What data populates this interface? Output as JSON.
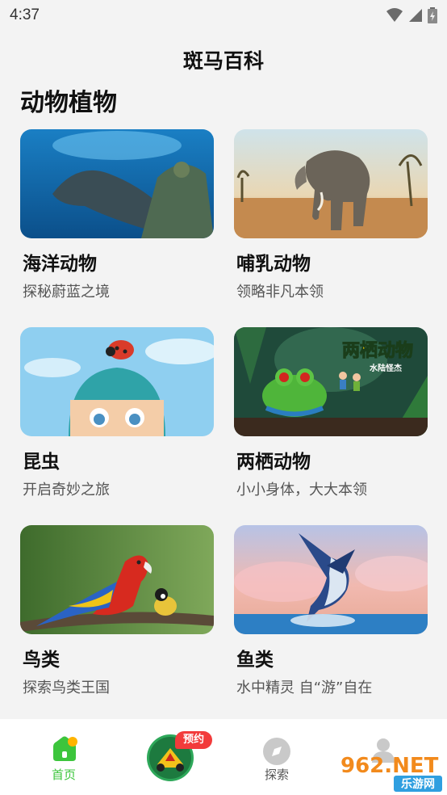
{
  "status_bar": {
    "time": "4:37"
  },
  "header": {
    "title": "斑马百科"
  },
  "section": {
    "title": "动物植物"
  },
  "cards": [
    {
      "title": "海洋动物",
      "subtitle": "探秘蔚蓝之境"
    },
    {
      "title": "哺乳动物",
      "subtitle": "领略非凡本领"
    },
    {
      "title": "昆虫",
      "subtitle": "开启奇妙之旅"
    },
    {
      "title": "两栖动物",
      "subtitle": "小小身体，大大本领"
    },
    {
      "title": "鸟类",
      "subtitle": "探索鸟类王国"
    },
    {
      "title": "鱼类",
      "subtitle": "水中精灵 自“游”自在"
    }
  ],
  "card_overlay_text": {
    "amphibian_logo": "两栖动物",
    "amphibian_logo_sub": "水陆怪杰"
  },
  "bottom_nav": {
    "home_label": "首页",
    "center_badge": "预约",
    "explore_label": "探索",
    "active_color": "#3cc53c"
  },
  "watermark": {
    "line1": "962.NET",
    "line2": "乐游网"
  }
}
